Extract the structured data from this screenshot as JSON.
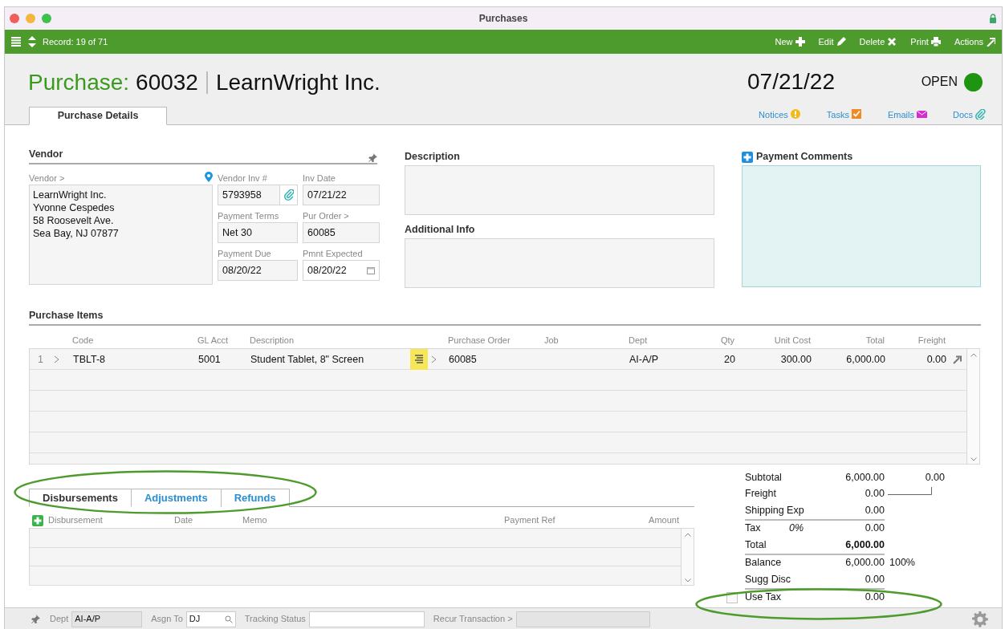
{
  "window": {
    "title": "Purchases"
  },
  "toolbar": {
    "record": "Record: 19 of 71",
    "actions": [
      {
        "label": "New"
      },
      {
        "label": "Edit"
      },
      {
        "label": "Delete"
      },
      {
        "label": "Print"
      },
      {
        "label": "Actions"
      }
    ]
  },
  "header": {
    "prefix": "Purchase:",
    "number": "60032",
    "vendor": "LearnWright Inc.",
    "date": "07/21/22",
    "status": {
      "label": "OPEN",
      "color": "#1e9410"
    }
  },
  "tabs": [
    {
      "label": "Purchase Details",
      "selected": true
    }
  ],
  "links": [
    {
      "label": "Notices"
    },
    {
      "label": "Tasks"
    },
    {
      "label": "Emails"
    },
    {
      "label": "Docs"
    }
  ],
  "vendor": {
    "title": "Vendor",
    "label": "Vendor >",
    "address": [
      "LearnWright Inc.",
      "Yvonne Cespedes",
      "58 Roosevelt Ave.",
      "Sea Bay, NJ 07877"
    ],
    "fields": [
      {
        "label": "Vendor Inv #",
        "value": "5793958",
        "kind": "attach"
      },
      {
        "label": "Inv Date",
        "value": "07/21/22",
        "kind": "plain"
      },
      {
        "label": "Payment Terms",
        "value": "Net 30",
        "kind": "plain"
      },
      {
        "label": "Pur Order >",
        "value": "60085",
        "kind": "plain"
      },
      {
        "label": "Payment Due",
        "value": "08/20/22",
        "kind": "plain"
      },
      {
        "label": "Pmnt Expected",
        "value": "08/20/22",
        "kind": "date"
      }
    ]
  },
  "description": {
    "title": "Description"
  },
  "additional_info": {
    "title": "Additional Info"
  },
  "payment_comments": {
    "title": "Payment Comments"
  },
  "items": {
    "title": "Purchase Items",
    "columns": [
      {
        "label": "Code"
      },
      {
        "label": "GL Acct"
      },
      {
        "label": "Description"
      },
      {
        "label": "Purchase Order"
      },
      {
        "label": "Job"
      },
      {
        "label": "Dept"
      },
      {
        "label": "Qty"
      },
      {
        "label": "Unit Cost"
      },
      {
        "label": "Total"
      },
      {
        "label": "Freight"
      }
    ],
    "rows": [
      {
        "line": "1",
        "code": "TBLT-8",
        "gl_acct": "5001",
        "description": "Student Tablet, 8\" Screen",
        "purchase_order": "60085",
        "dept": "AI-A/P",
        "qty": "20",
        "unit_cost": "300.00",
        "total": "6,000.00",
        "freight": "0.00"
      }
    ]
  },
  "bottom_tabs": [
    {
      "label": "Disbursements",
      "selected": true
    },
    {
      "label": "Adjustments",
      "selected": false
    },
    {
      "label": "Refunds",
      "selected": false
    }
  ],
  "disbursements": {
    "columns": [
      {
        "label": "Disbursement"
      },
      {
        "label": "Date"
      },
      {
        "label": "Memo"
      },
      {
        "label": "Payment Ref"
      },
      {
        "label": "Amount"
      }
    ]
  },
  "totals": {
    "side_value": "0.00",
    "rows": [
      {
        "label": "Subtotal",
        "value": "6,000.00",
        "rule_after": false
      },
      {
        "label": "Freight",
        "value": "0.00",
        "rule_after": false
      },
      {
        "label": "Shipping Exp",
        "value": "0.00",
        "rule_after": true
      },
      {
        "label": "Tax",
        "rate": "0%",
        "value": "0.00",
        "rule_after": false
      },
      {
        "label": "Total",
        "value": "6,000.00",
        "kind": "total",
        "rule_after": true
      },
      {
        "label": "Balance",
        "value": "6,000.00",
        "extra": "100%",
        "rule_after": false
      },
      {
        "label": "Sugg Disc",
        "value": "0.00",
        "rule_after": true
      }
    ]
  },
  "use_tax": {
    "label": "Use Tax",
    "value": "0.00",
    "checked": false
  },
  "footer": {
    "fields": [
      {
        "label": "Dept",
        "value": "AI-A/P",
        "kind": "plain",
        "disabled": true
      },
      {
        "label": "Asgn To",
        "value": "DJ",
        "kind": "search",
        "disabled": false
      },
      {
        "label": "Tracking Status",
        "kind": "plain",
        "disabled": false
      },
      {
        "label": "Recur Transaction >",
        "kind": "plain",
        "disabled": true
      }
    ]
  },
  "annotations": [
    {
      "kind": "ellipse"
    },
    {
      "kind": "ellipse"
    }
  ]
}
